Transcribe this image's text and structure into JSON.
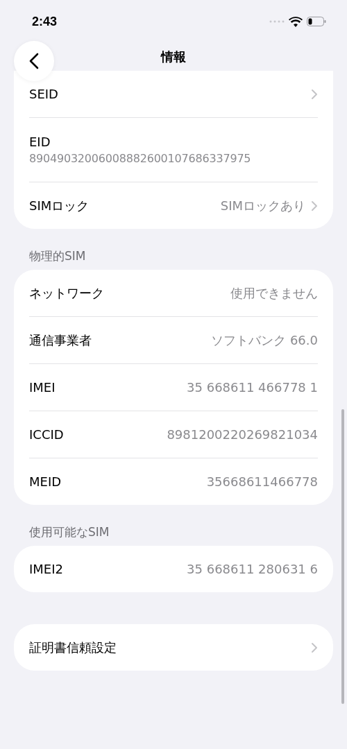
{
  "status_bar": {
    "time": "2:43"
  },
  "nav": {
    "title": "情報"
  },
  "groups": [
    {
      "rows": [
        {
          "kind": "inline",
          "label": "SEID",
          "chevron": true
        },
        {
          "kind": "stacked",
          "label": "EID",
          "value": "89049032006008882600107686337975",
          "chevron": false
        },
        {
          "kind": "inline",
          "label": "SIMロック",
          "value": "SIMロックあり",
          "chevron": true
        }
      ]
    },
    {
      "header": "物理的SIM",
      "rows": [
        {
          "kind": "inline",
          "label": "ネットワーク",
          "value": "使用できません",
          "chevron": false
        },
        {
          "kind": "inline",
          "label": "通信事業者",
          "value": "ソフトバンク 66.0",
          "chevron": false
        },
        {
          "kind": "inline",
          "label": "IMEI",
          "value": "35 668611 466778 1",
          "chevron": false
        },
        {
          "kind": "inline",
          "label": "ICCID",
          "value": "8981200220269821034",
          "chevron": false
        },
        {
          "kind": "inline",
          "label": "MEID",
          "value": "35668611466778",
          "chevron": false
        }
      ]
    },
    {
      "header": "使用可能なSIM",
      "rows": [
        {
          "kind": "inline",
          "label": "IMEI2",
          "value": "35 668611 280631 6",
          "chevron": false
        }
      ]
    },
    {
      "rows": [
        {
          "kind": "inline",
          "label": "証明書信頼設定",
          "chevron": true
        }
      ]
    }
  ]
}
